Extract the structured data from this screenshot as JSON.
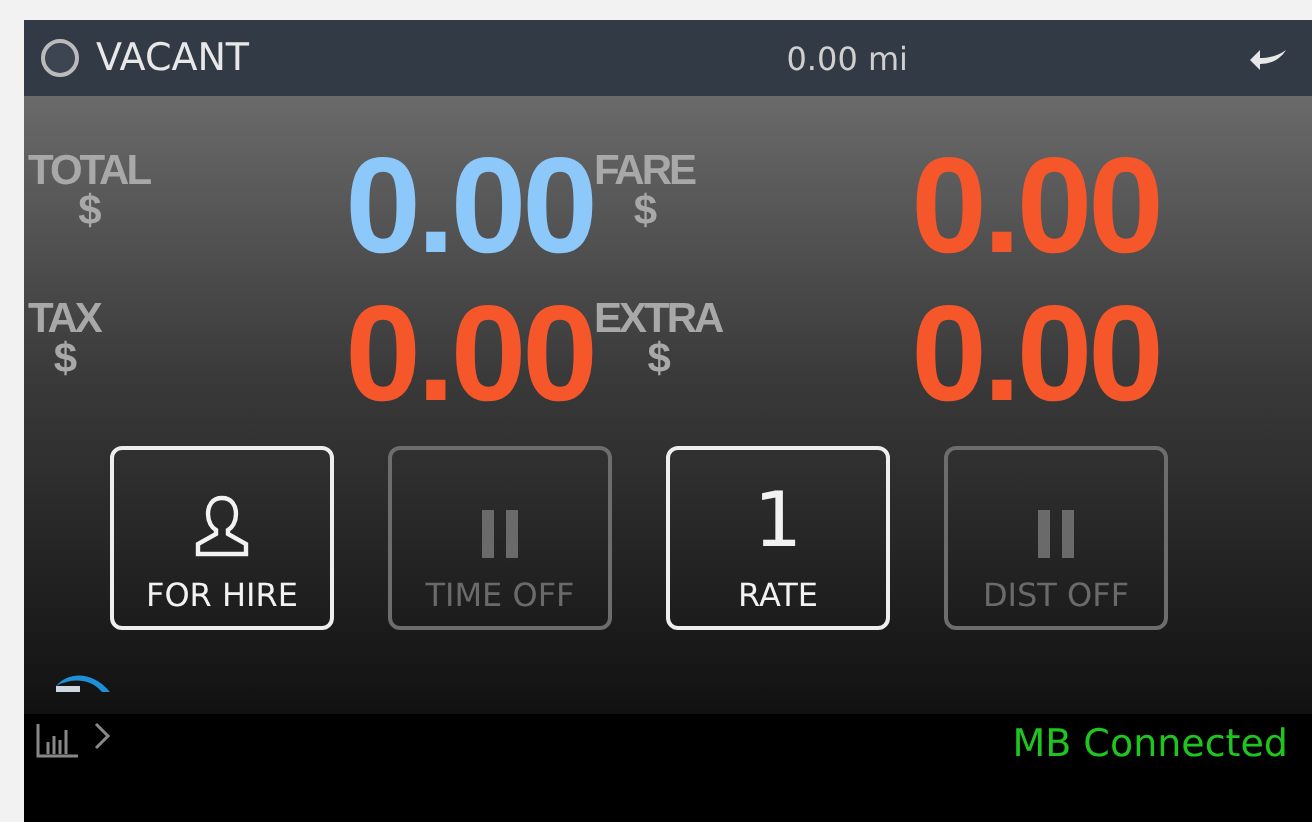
{
  "header": {
    "status": "VACANT",
    "distance": "0.00 mi"
  },
  "amounts": [
    {
      "label": "TOTAL",
      "unit": "$",
      "value": "0.00",
      "color": "#8cc8fa"
    },
    {
      "label": "FARE",
      "unit": "$",
      "value": "0.00",
      "color": "#f5572a"
    },
    {
      "label": "TAX",
      "unit": "$",
      "value": "0.00",
      "color": "#f5572a"
    },
    {
      "label": "EXTRA",
      "unit": "$",
      "value": "0.00",
      "color": "#f5572a"
    }
  ],
  "buttons": [
    {
      "kind": "person",
      "label": "FOR HIRE",
      "disabled": false
    },
    {
      "kind": "pause",
      "label": "TIME OFF",
      "disabled": true
    },
    {
      "kind": "number",
      "number": "1",
      "label": "RATE",
      "disabled": false
    },
    {
      "kind": "pause",
      "label": "DIST OFF",
      "disabled": true
    }
  ],
  "status_bar": {
    "connection": "MB Connected"
  }
}
